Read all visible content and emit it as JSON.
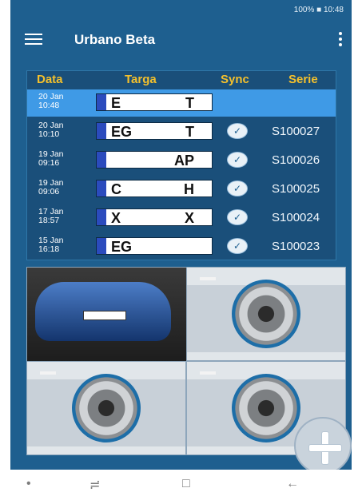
{
  "status": {
    "text": "100% ■ 10:48"
  },
  "app": {
    "title": "Urbano Beta"
  },
  "table": {
    "headers": [
      "Data",
      "Targa",
      "Sync",
      "Serie"
    ],
    "rows": [
      {
        "date": "20 Jan",
        "time": "10:48",
        "plate_left": "E",
        "plate_right": "T",
        "serie": "",
        "sync": false,
        "selected": true
      },
      {
        "date": "20 Jan",
        "time": "10:10",
        "plate_left": "EG",
        "plate_right": "T",
        "serie": "S100027",
        "sync": true,
        "selected": false
      },
      {
        "date": "19 Jan",
        "time": "09:16",
        "plate_left": "",
        "plate_right": "AP",
        "serie": "S100026",
        "sync": true,
        "selected": false
      },
      {
        "date": "19 Jan",
        "time": "09:06",
        "plate_left": "C",
        "plate_right": "H",
        "serie": "S100025",
        "sync": true,
        "selected": false
      },
      {
        "date": "17 Jan",
        "time": "18:57",
        "plate_left": "X",
        "plate_right": "X",
        "serie": "S100024",
        "sync": true,
        "selected": false
      },
      {
        "date": "15 Jan",
        "time": "16:18",
        "plate_left": "EG",
        "plate_right": "",
        "serie": "S100023",
        "sync": true,
        "selected": false
      }
    ]
  },
  "nav": {
    "recent": "□",
    "back": "←"
  }
}
